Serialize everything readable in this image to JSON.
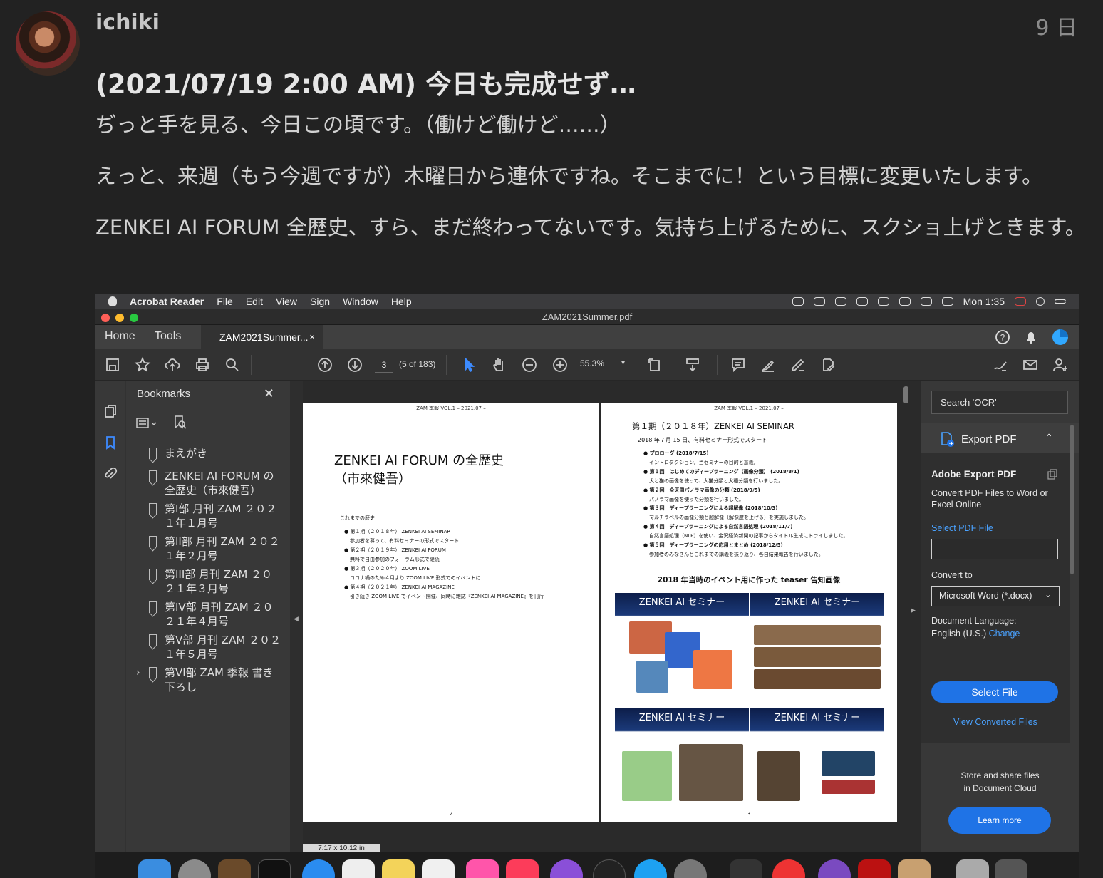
{
  "post": {
    "username": "ichiki",
    "date": "9 日",
    "title": "(2021/07/19 2:00 AM) 今日も完成せず…",
    "paragraphs": [
      "ぢっと手を見る、今日この頃です。（働けど働けど……）",
      "えっと、来週（もう今週ですが）木曜日から連休ですね。そこまでに！という目標に変更いたします。",
      "ZENKEI AI FORUM 全歴史、すら、まだ終わってないです。気持ち上げるために、スクショ上げときます。"
    ]
  },
  "menubar": {
    "app": "Acrobat Reader",
    "items": [
      "File",
      "Edit",
      "View",
      "Sign",
      "Window",
      "Help"
    ],
    "clock": "Mon 1:35"
  },
  "window": {
    "title": "ZAM2021Summer.pdf"
  },
  "tabs": {
    "home": "Home",
    "tools": "Tools",
    "doc": "ZAM2021Summer...",
    "close": "×"
  },
  "toolbar": {
    "page_input": "3",
    "page_of": "(5 of 183)",
    "zoom": "55.3%"
  },
  "bookmarks": {
    "header": "Bookmarks",
    "close": "✕",
    "items": [
      "まえがき",
      "ZENKEI AI FORUM の全歴史（市來健吾）",
      "第I部 月刊 ZAM ２０２１年１月号",
      "第II部 月刊 ZAM ２０２１年２月号",
      "第III部 月刊 ZAM ２０２１年３月号",
      "第IV部 月刊 ZAM ２０２１年４月号",
      "第V部 月刊 ZAM ２０２１年５月号",
      "第VI部 ZAM 季報 書き下ろし"
    ],
    "expand": "›"
  },
  "page_left": {
    "running_head": "ZAM 季報 VOL.1 – 2021.07 –",
    "title_line1": "ZENKEI AI FORUM の全歴史",
    "title_line2": "（市來健吾）",
    "sub": "これまでの歴史",
    "list": [
      "● 第１期（２０１８年） ZENKEI AI SEMINAR",
      "参加者を募って、有料セミナーの形式でスタート",
      "● 第２期（２０１９年） ZENKEI AI FORUM",
      "無料で自由参加のフォーラム形式で継続",
      "● 第３期（２０２０年） ZOOM LIVE",
      "コロナ禍のため４月より ZOOM LIVE 形式でのイベントに",
      "● 第４期（２０２１年） ZENKEI AI MAGAZINE",
      "引き続き ZOOM LIVE でイベント開催、同時に雑誌『ZENKEI AI MAGAZINE』を刊行"
    ],
    "page_number": "2",
    "size_label": "7.17 x 10.12 in"
  },
  "page_right": {
    "running_head": "ZAM 季報 VOL.1 – 2021.07 –",
    "heading": "第１期（２０１８年）ZENKEI AI SEMINAR",
    "sub": "2018 年７月 15 日、有料セミナー形式でスタート",
    "list": [
      "● プロローグ (2018/7/15)",
      "イントロダクション。当セミナーの目的と意義。",
      "● 第１回　はじめてのディープラーニング（画像分類） (2018/8/1)",
      "犬と猫の画像を使って、大猫分類と犬種分類を行いました。",
      "● 第２回　全天周パノラマ画像の分類 (2018/9/5)",
      "パノラマ画像を使った分類を行いました。",
      "● 第３回　ディープラーニングによる超解像 (2018/10/3)",
      "マルチラベルの画像分類と超解像（解像度を上げる）を実施しました。",
      "● 第４回　ディープラーニングによる自然言語処理 (2018/11/7)",
      "自然言語処理（NLP）を使い、金沢経済新聞の記事からタイトル生成にトライしました。",
      "● 第５回　ディープラーニングの応用とまとめ (2018/12/5)",
      "参加者のみなさんとこれまでの講義を振り返り、各自結果報告を行いました。"
    ],
    "teaser_heading": "2018 年当時のイベント用に作った teaser 告知画像",
    "thumb_label": "ZENKEI AI セミナー",
    "page_number": "3"
  },
  "right_pane": {
    "search": "Search 'OCR'",
    "export_header": "Export PDF",
    "title": "Adobe Export PDF",
    "desc": "Convert PDF Files to Word or Excel Online",
    "select_link": "Select PDF File",
    "convert_to": "Convert to",
    "format": "Microsoft Word (*.docx)",
    "lang_label": "Document Language:",
    "lang_value": "English (U.S.)",
    "lang_change": "Change",
    "select_button": "Select File",
    "view_converted": "View Converted Files",
    "store_line1": "Store and share files",
    "store_line2": "in Document Cloud",
    "learn_more": "Learn more"
  },
  "colors": {
    "accent": "#1f73e6",
    "link": "#4aa2ff",
    "bg": "#222222"
  }
}
